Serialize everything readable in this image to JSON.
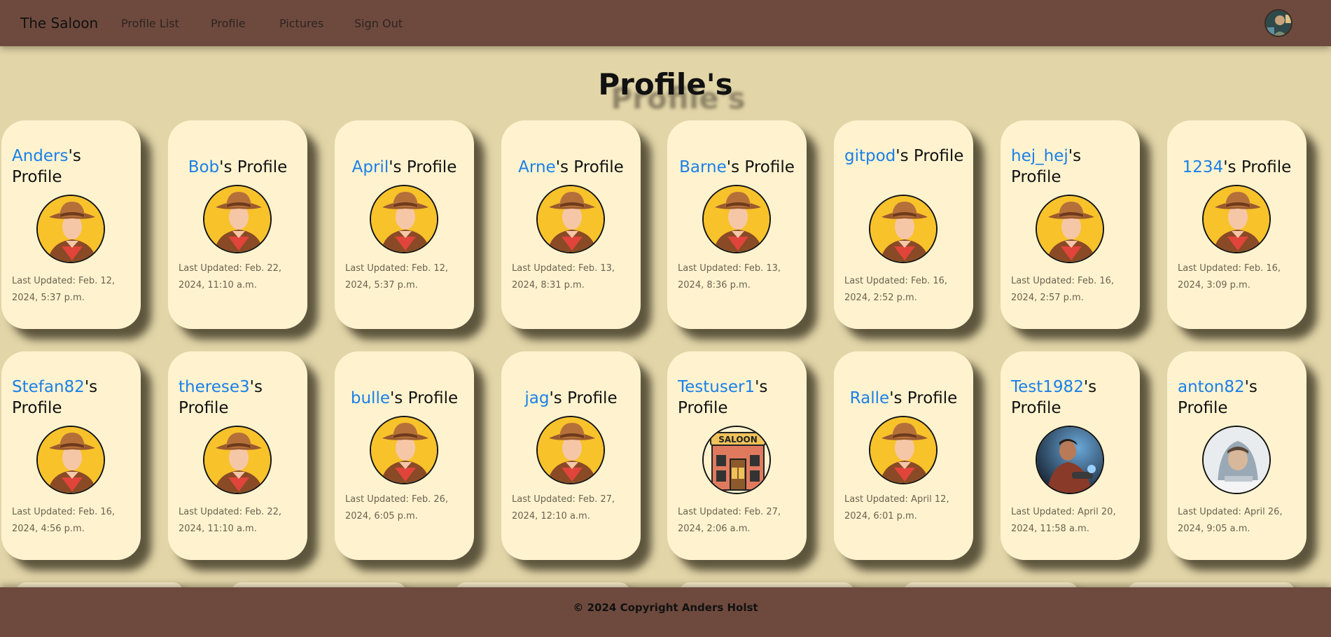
{
  "nav": {
    "brand": "The Saloon",
    "links": [
      "Profile List",
      "Profile",
      "Pictures",
      "Sign Out"
    ]
  },
  "page": {
    "title": "Profile's"
  },
  "profiles": [
    {
      "name": "Anders",
      "suffix": "'s Profile",
      "updated": "Last Updated: Feb. 12, 2024, 5:37 p.m.",
      "avatar": "cowboy"
    },
    {
      "name": "Bob",
      "suffix": "'s Profile",
      "updated": "Last Updated: Feb. 22, 2024, 11:10 a.m.",
      "avatar": "cowboy"
    },
    {
      "name": "April",
      "suffix": "'s Profile",
      "updated": "Last Updated: Feb. 12, 2024, 5:37 p.m.",
      "avatar": "cowboy"
    },
    {
      "name": "Arne",
      "suffix": "'s Profile",
      "updated": "Last Updated: Feb. 13, 2024, 8:31 p.m.",
      "avatar": "cowboy"
    },
    {
      "name": "Barne",
      "suffix": "'s Profile",
      "updated": "Last Updated: Feb. 13, 2024, 8:36 p.m.",
      "avatar": "cowboy"
    },
    {
      "name": "gitpod",
      "suffix": "'s Profile",
      "updated": "Last Updated: Feb. 16, 2024, 2:52 p.m.",
      "avatar": "cowboy"
    },
    {
      "name": "hej_hej",
      "suffix": "'s Profile",
      "updated": "Last Updated: Feb. 16, 2024, 2:57 p.m.",
      "avatar": "cowboy"
    },
    {
      "name": "1234",
      "suffix": "'s Profile",
      "updated": "Last Updated: Feb. 16, 2024, 3:09 p.m.",
      "avatar": "cowboy"
    },
    {
      "name": "Stefan82",
      "suffix": "'s Profile",
      "updated": "Last Updated: Feb. 16, 2024, 4:56 p.m.",
      "avatar": "cowboy"
    },
    {
      "name": "therese3",
      "suffix": "'s Profile",
      "updated": "Last Updated: Feb. 22, 2024, 11:10 a.m.",
      "avatar": "cowboy"
    },
    {
      "name": "bulle",
      "suffix": "'s Profile",
      "updated": "Last Updated: Feb. 26, 2024, 6:05 p.m.",
      "avatar": "cowboy"
    },
    {
      "name": "jag",
      "suffix": "'s Profile",
      "updated": "Last Updated: Feb. 27, 2024, 12:10 a.m.",
      "avatar": "cowboy"
    },
    {
      "name": "Testuser1",
      "suffix": "'s Profile",
      "updated": "Last Updated: Feb. 27, 2024, 2:06 a.m.",
      "avatar": "saloon",
      "avatar_label": "SALOON"
    },
    {
      "name": "Ralle",
      "suffix": "'s Profile",
      "updated": "Last Updated: April 12, 2024, 6:01 p.m.",
      "avatar": "cowboy"
    },
    {
      "name": "Test1982",
      "suffix": "'s Profile",
      "updated": "Last Updated: April 20, 2024, 11:58 a.m.",
      "avatar": "photo-man"
    },
    {
      "name": "anton82",
      "suffix": "'s Profile",
      "updated": "Last Updated: April 26, 2024, 9:05 a.m.",
      "avatar": "photo-hoodie"
    }
  ],
  "footer": {
    "text": "© 2024 Copyright Anders Holst"
  }
}
